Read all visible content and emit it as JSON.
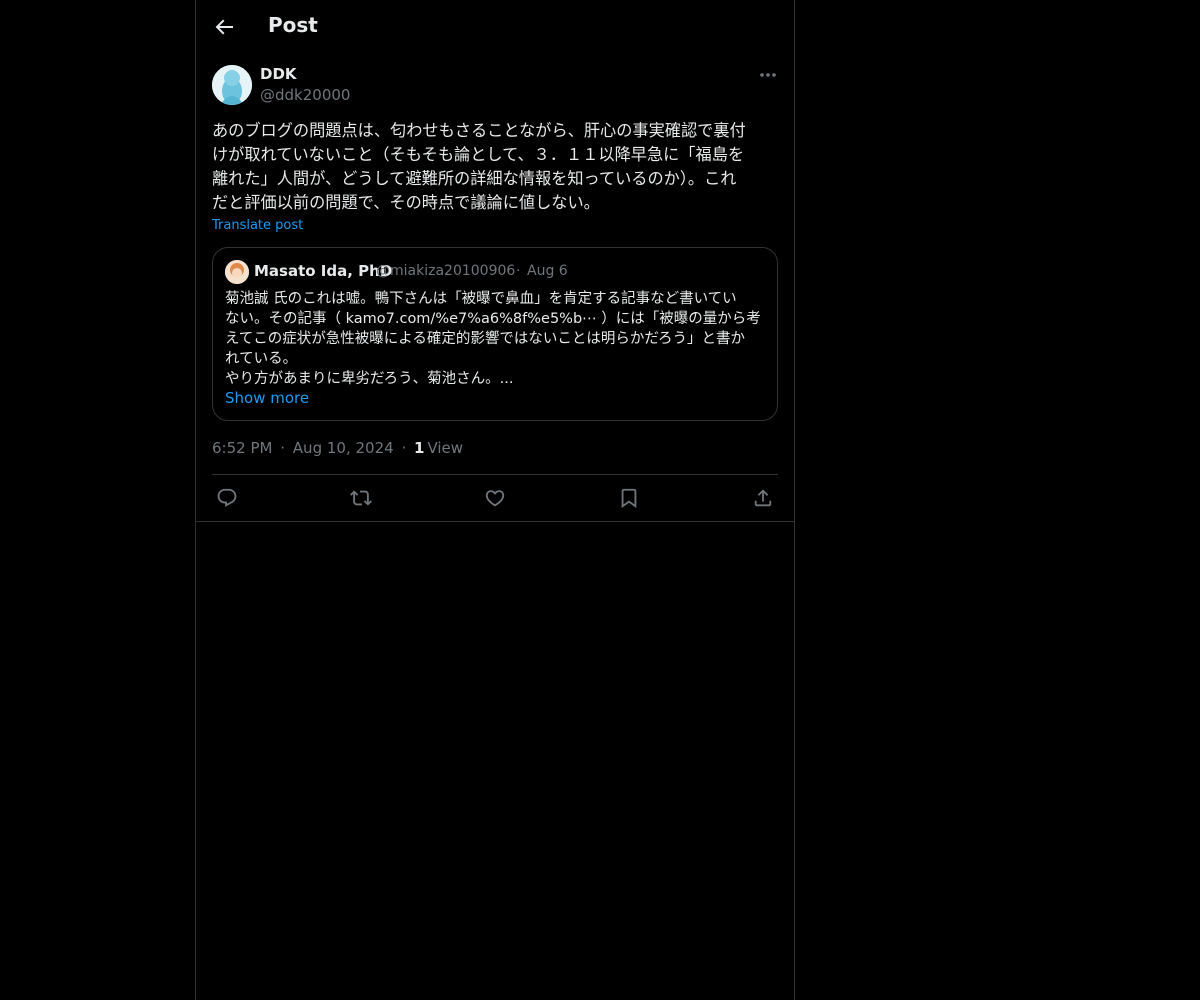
{
  "header": {
    "title": "Post"
  },
  "post": {
    "author_name": "DDK",
    "author_handle": "@ddk20000",
    "text": "あのブログの問題点は、匂わせもさることながら、肝心の事実確認で裏付\nけが取れていないこと（そもそも論として、３．１１以降早急に「福島を\n離れた」人間が、どうして避難所の詳細な情報を知っているのか）。これ\nだと評価以前の問題で、その時点で議論に値しない。",
    "translate_label": "Translate post",
    "time": "6:52 PM",
    "date": "Aug 10, 2024",
    "views_count": "1",
    "views_label": "View"
  },
  "quote": {
    "author_name": "Masato Ida, PhD",
    "author_handle": "@miakiza20100906",
    "date": "Aug 6",
    "text": "菊池誠 氏のこれは嘘。鴨下さんは「被曝で鼻血」を肯定する記事など書いてい\nない。その記事（ kamo7.com/%e7%a6%8f%e5%b⋯ ）には「被曝の量から考\nえてこの症状が急性被曝による確定的影響ではないことは明らかだろう」と書か\nれている。\nやり方があまりに卑劣だろう、菊池さん。...",
    "show_more_label": "Show more"
  },
  "separator": "·",
  "actions": [
    "reply-icon",
    "repost-icon",
    "like-icon",
    "bookmark-icon",
    "share-icon"
  ],
  "colors": {
    "background": "#000000",
    "text": "#e7e9ea",
    "muted": "#71767b",
    "link": "#1d9bf0",
    "border": "#2f3336"
  }
}
